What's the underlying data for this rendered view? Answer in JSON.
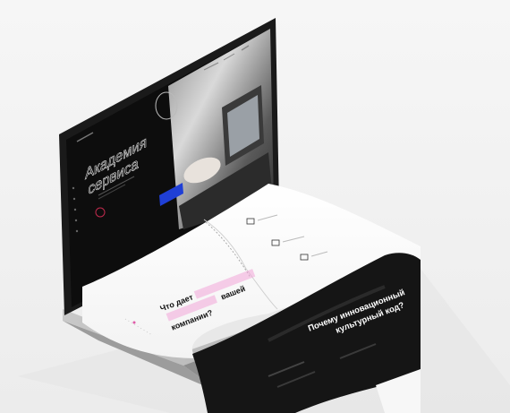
{
  "hero": {
    "title_line1": "Академия",
    "title_line2": "сервиса"
  },
  "section_a": {
    "q_part1": "Что дает",
    "q_part2": "вашей",
    "q_part3": "компании?"
  },
  "section_b": {
    "line1": "Почему инновационный",
    "line2": "культурный код?"
  },
  "colors": {
    "accent_blue": "#1f3fd6",
    "accent_pink": "#f2a6d8",
    "screen_black": "#0d0d0d"
  }
}
